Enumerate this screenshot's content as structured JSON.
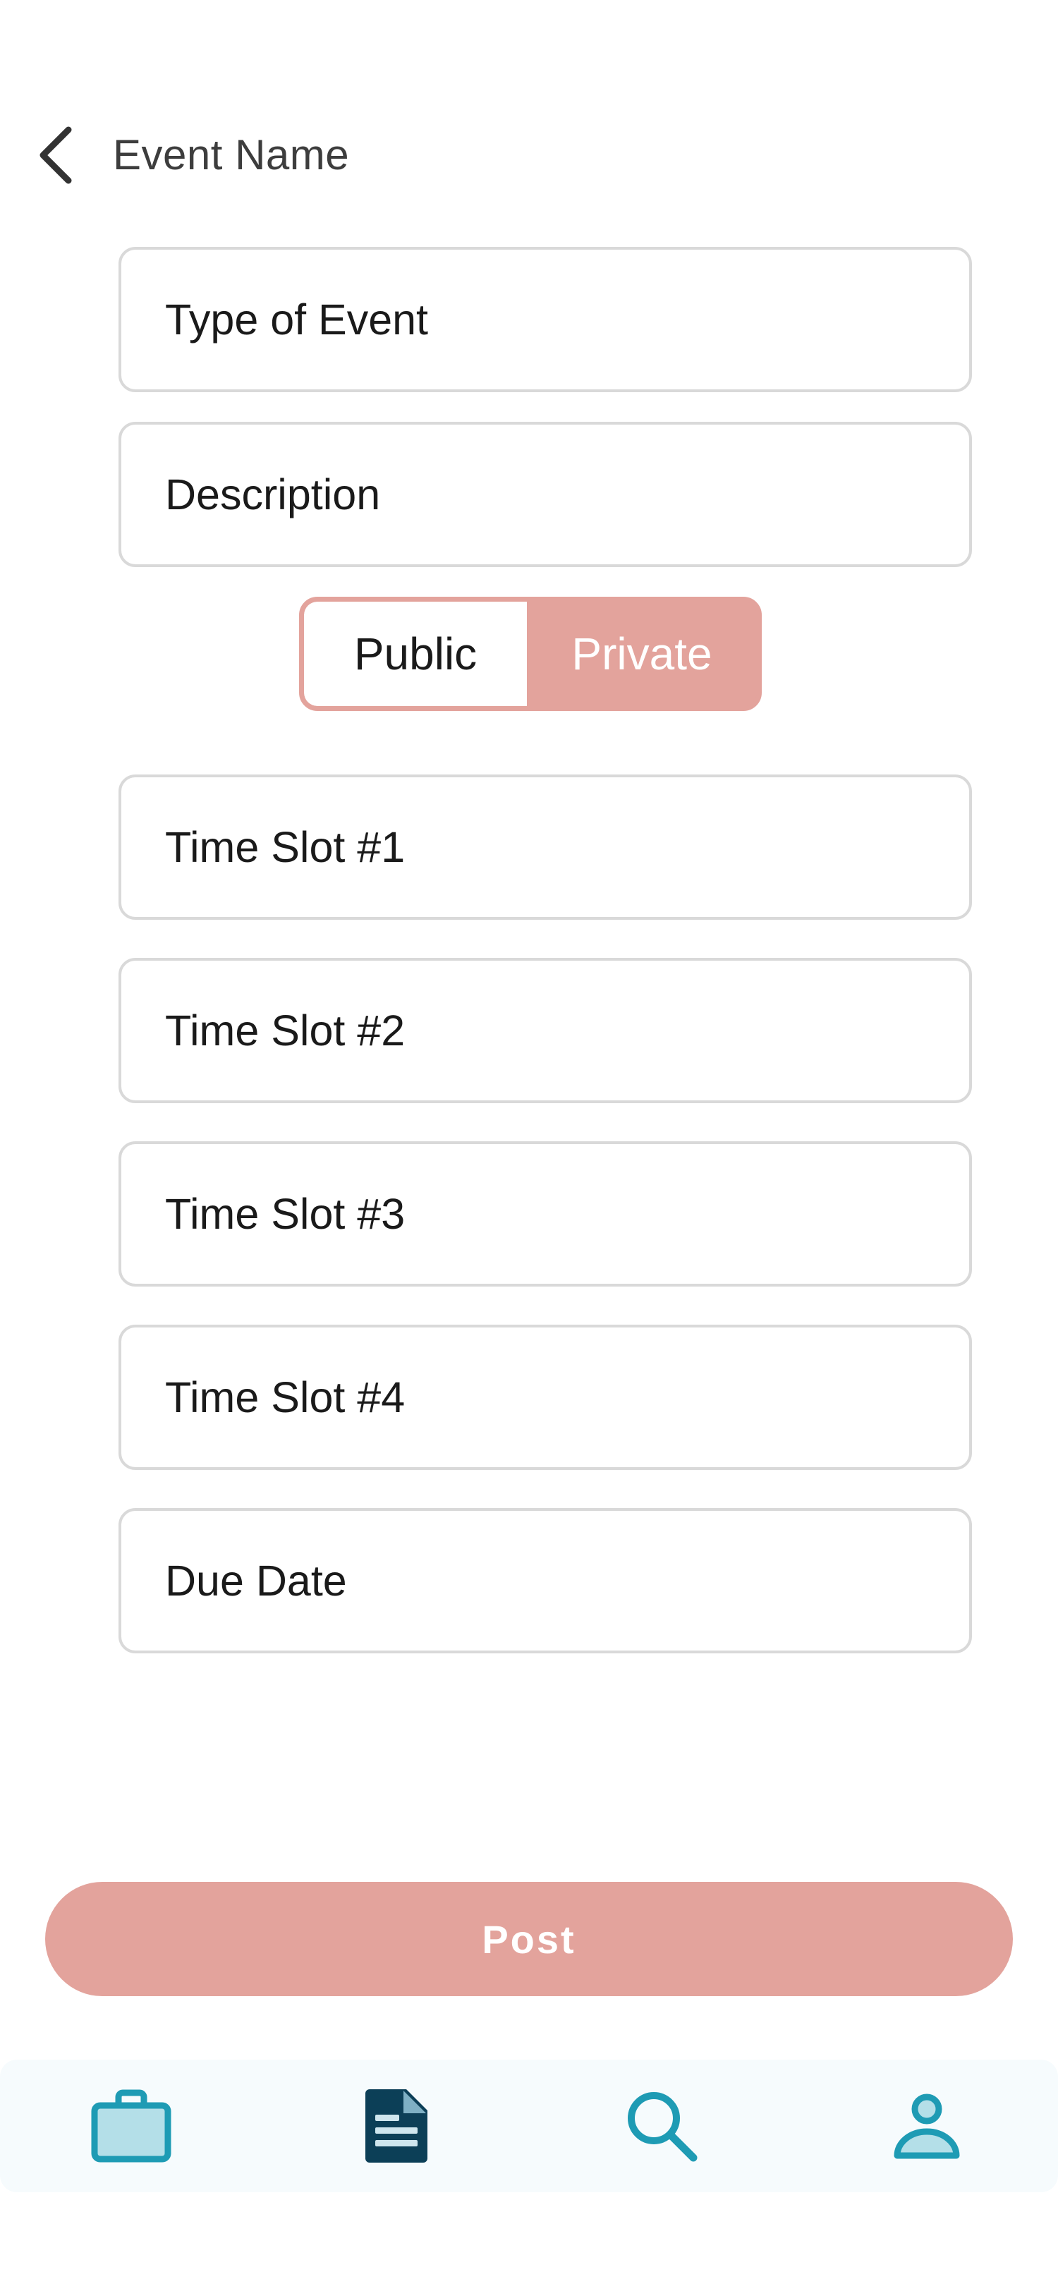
{
  "header": {
    "back_icon": "chevron-left-icon",
    "title": "Event Name"
  },
  "form": {
    "type_of_event": "Type of Event",
    "description": "Description",
    "time_slot_1": "Time Slot #1",
    "time_slot_2": "Time Slot #2",
    "time_slot_3": "Time Slot #3",
    "time_slot_4": "Time Slot #4",
    "due_date": "Due Date"
  },
  "visibility_toggle": {
    "public_label": "Public",
    "private_label": "Private",
    "selected": "Private"
  },
  "post_button": {
    "label": "Post"
  },
  "bottom_nav": {
    "items": [
      {
        "icon": "briefcase-icon"
      },
      {
        "icon": "document-icon",
        "active": true
      },
      {
        "icon": "search-icon"
      },
      {
        "icon": "profile-icon"
      }
    ]
  },
  "colors": {
    "accent": "#e3a39c",
    "nav_teal": "#1e9bb4",
    "nav_dark": "#0c3f57",
    "field_border": "#d9d9d9"
  }
}
